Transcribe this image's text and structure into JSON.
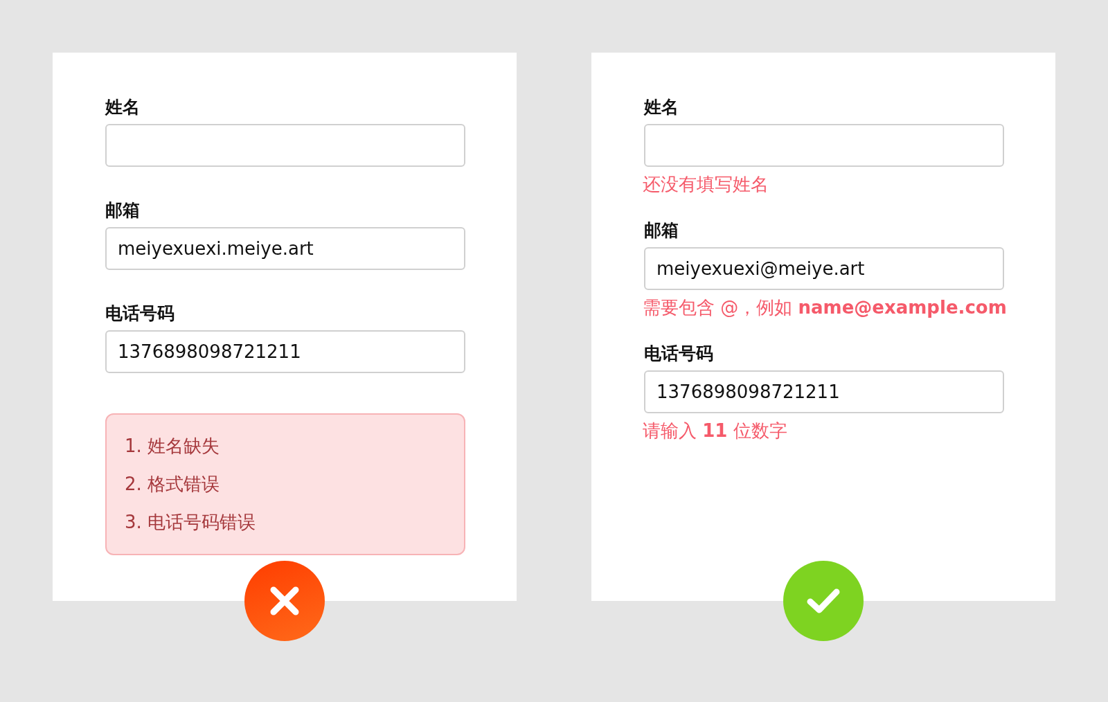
{
  "panels": [
    {
      "kind": "wrong",
      "fields": [
        {
          "label": "姓名"
        },
        {
          "label": "邮箱",
          "value": "meiyexuexi.meiye.art"
        },
        {
          "label": "电话号码",
          "value": "1376898098721211"
        }
      ],
      "error_list": [
        "1. 姓名缺失",
        "2. 格式错误",
        "3. 电话号码错误"
      ]
    },
    {
      "kind": "right",
      "fields": [
        {
          "label": "姓名",
          "error": "还没有填写姓名"
        },
        {
          "label": "邮箱",
          "value": "meiyexuexi@meiye.art",
          "error": "需要包含 @，例如 **name@example.com**"
        },
        {
          "label": "电话号码",
          "value": "1376898098721211",
          "error": "请输入 **11** 位数字"
        }
      ]
    }
  ]
}
